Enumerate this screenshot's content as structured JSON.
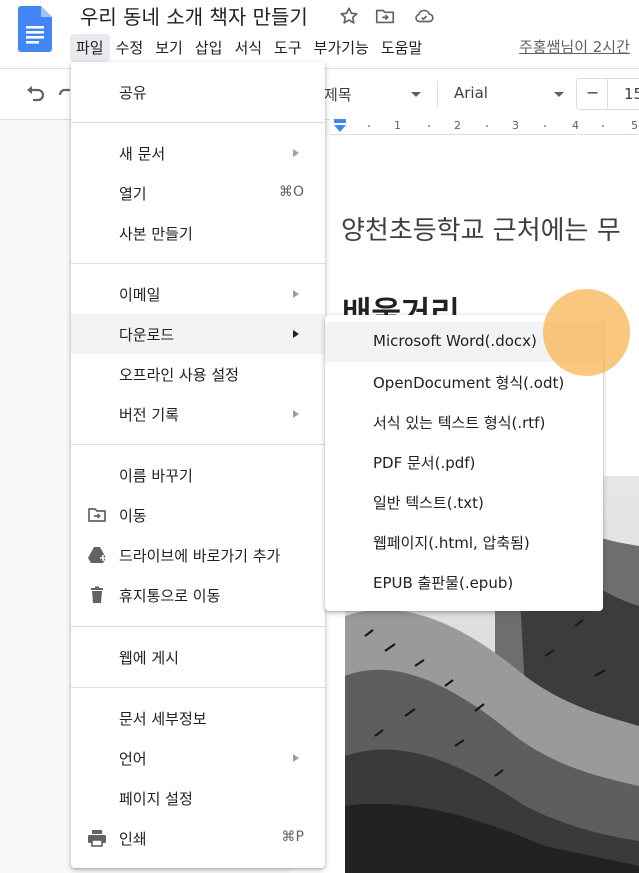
{
  "app": {
    "doc_title": "우리 동네 소개 책자 만들기",
    "last_edit": "주홍쌤님이 2시간"
  },
  "menubar": [
    {
      "label": "파일",
      "active": true
    },
    {
      "label": "수정"
    },
    {
      "label": "보기"
    },
    {
      "label": "삽입"
    },
    {
      "label": "서식"
    },
    {
      "label": "도구"
    },
    {
      "label": "부가기능"
    },
    {
      "label": "도움말"
    }
  ],
  "toolbar": {
    "style_value": "제목",
    "font_value": "Arial",
    "font_size": "15",
    "decrease_label": "−"
  },
  "ruler": {
    "numbers": [
      "1",
      "2",
      "3",
      "4",
      "5"
    ]
  },
  "document": {
    "body_text": "양천초등학교 근처에는 무",
    "heading_text": "배울거리"
  },
  "file_menu": {
    "items": [
      {
        "label": "공유"
      },
      {
        "label": "새 문서",
        "submenu": true
      },
      {
        "label": "열기",
        "shortcut": "⌘O"
      },
      {
        "label": "사본 만들기"
      },
      {
        "label": "이메일",
        "submenu": true
      },
      {
        "label": "다운로드",
        "submenu": true,
        "highlighted": true
      },
      {
        "label": "오프라인 사용 설정"
      },
      {
        "label": "버전 기록",
        "submenu": true
      },
      {
        "label": "이름 바꾸기"
      },
      {
        "label": "이동",
        "icon": "folder-move-icon"
      },
      {
        "label": "드라이브에 바로가기 추가",
        "icon": "drive-shortcut-icon"
      },
      {
        "label": "휴지통으로 이동",
        "icon": "trash-icon"
      },
      {
        "label": "웹에 게시"
      },
      {
        "label": "문서 세부정보"
      },
      {
        "label": "언어",
        "submenu": true
      },
      {
        "label": "페이지 설정"
      },
      {
        "label": "인쇄",
        "shortcut": "⌘P",
        "icon": "printer-icon"
      }
    ]
  },
  "download_menu": {
    "items": [
      {
        "label": "Microsoft Word(.docx)",
        "highlighted": true
      },
      {
        "label": "OpenDocument 형식(.odt)"
      },
      {
        "label": "서식 있는 텍스트 형식(.rtf)"
      },
      {
        "label": "PDF 문서(.pdf)"
      },
      {
        "label": "일반 텍스트(.txt)"
      },
      {
        "label": "웹페이지(.html, 압축됨)"
      },
      {
        "label": "EPUB 출판물(.epub)"
      }
    ]
  },
  "colors": {
    "docs_blue": "#4285f4",
    "highlight": "#f1f3f4",
    "cursor": "#f7b24b"
  }
}
